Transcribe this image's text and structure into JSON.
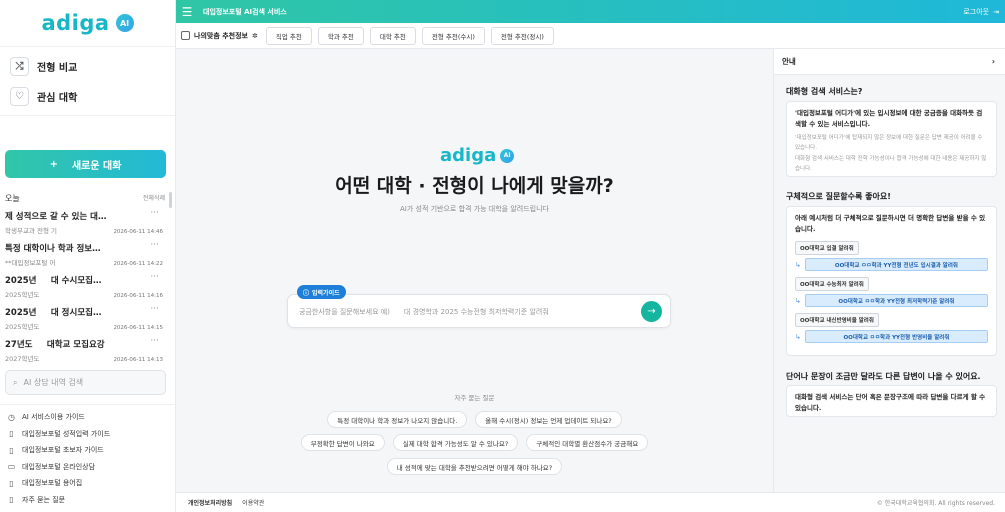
{
  "sidebar": {
    "logo_text": "adiga",
    "logo_badge": "AI",
    "nav": [
      {
        "label": "전형 비교",
        "icon": "shuffle-icon"
      },
      {
        "label": "관심 대학",
        "icon": "heart-icon"
      }
    ],
    "new_chat_label": "새로운 대화",
    "history_title": "오늘",
    "history_delete": "전체삭제",
    "history": [
      {
        "title": "제 성적으로 갈 수 있는 대…",
        "sub": "학생부교과 전형 기",
        "date": "2026-06-11 14:46"
      },
      {
        "title": "특정 대학이나 학과 정보…",
        "sub": "**대입정보포털 어",
        "date": "2026-06-11 14:22"
      },
      {
        "title": "2025년 　 대 수시모집…",
        "sub": "2025학년도",
        "date": "2026-06-11 14:16"
      },
      {
        "title": "2025년 　 대 정시모집…",
        "sub": "2025학년도",
        "date": "2026-06-11 14:15"
      },
      {
        "title": "27년도 　 대학교 모집요강",
        "sub": "2027학년도",
        "date": "2026-06-11 14:13"
      }
    ],
    "search_placeholder": "AI 상담 내역 검색",
    "links": [
      {
        "label": "AI 서비스이용 가이드",
        "icon": "clock-icon"
      },
      {
        "label": "대입정보포털 성적입력 가이드",
        "icon": "book-icon"
      },
      {
        "label": "대입정보포털 초보자 가이드",
        "icon": "book-icon"
      },
      {
        "label": "대입정보포털 온라인상담",
        "icon": "chat-icon"
      },
      {
        "label": "대입정보포털 용어집",
        "icon": "book-icon"
      },
      {
        "label": "자주 묻는 질문",
        "icon": "book-icon"
      }
    ]
  },
  "topbar": {
    "title": "대입정보포털 AI검색 서비스",
    "logout": "로그아웃"
  },
  "subbar": {
    "label": "나의맞춤 추천정보",
    "tabs": [
      "직업 추천",
      "학과 추천",
      "대학 추천",
      "전형 추천(수시)",
      "전형 추천(정시)"
    ]
  },
  "main": {
    "logo_text": "adiga",
    "logo_badge": "AI",
    "title": "어떤 대학 · 전형이 나에게 맞을까?",
    "subtitle": "AI가 성적 기반으로 합격 가능 대학을 알려드립니다",
    "guide_label": "입력가이드",
    "input_placeholder": "궁금한사항을 질문해보세요 예)　　대 경영학과 2025 수능전형 최저학력기준 알려줘",
    "faq_title": "자주 묻는 질문",
    "faq_rows": [
      [
        "특정 대학이나 학과 정보가 나오지 않습니다.",
        "올해 수시(정시) 정보는 언제 업데이트 되나요?"
      ],
      [
        "부정확한 답변이 나와요",
        "실제 대학 합격 가능성도 알 수 있나요?",
        "구체적인 대학별 환산점수가 궁금해요"
      ],
      [
        "내 성적에 맞는 대학을 추천받으려면 어떻게 해야 하나요?"
      ]
    ]
  },
  "footer": {
    "privacy": "개인정보처리방침",
    "terms": "이용약관",
    "copyright": "© 한국대학교육협의회. All rights reserved."
  },
  "panel": {
    "title": "안내",
    "s1_title": "대화형 검색 서비스는?",
    "s1_bold": "'대입정보포털 어디가'에 있는 입시정보에 대한 궁금증을 대화하듯 검색할 수 있는 서비스입니다.",
    "s1_note1": "'대입정보포털 어디가'에 탑재되지 않은 정보에 대한 질문은 답변 제공이 어려울 수 있습니다.",
    "s1_note2": "대화형 검색 서비스는 대학 진학 가능성이나 합격 가능성에 대한 내용은 제공하지 않습니다.",
    "s2_title": "구체적으로 질문할수록 좋아요!",
    "s2_bold": "아래 예시처럼 더 구체적으로 질문하시면 더 명확한 답변을 받을 수 있습니다.",
    "examples": [
      {
        "q": "OO대학교 입결 알려줘",
        "a": "OO대학교 ㅁㅁ학과 YY전형 전년도 입시결과 알려줘"
      },
      {
        "q": "OO대학교 수능최저 알려줘",
        "a": "OO대학교 ㅁㅁ학과 YY전형 최저학력기준 알려줘"
      },
      {
        "q": "OO대학교 내신반영비율 알려줘",
        "a": "OO대학교 ㅁㅁ학과 YY전형 반영비율 알려줘"
      }
    ],
    "s3_title": "단어나 문장이 조금만 달라도 다른 답변이 나올 수 있어요.",
    "s3_bold": "대화형 검색 서비스는 단어 혹은 문장구조에 따라 답변을 다르게 할 수 있습니다."
  }
}
